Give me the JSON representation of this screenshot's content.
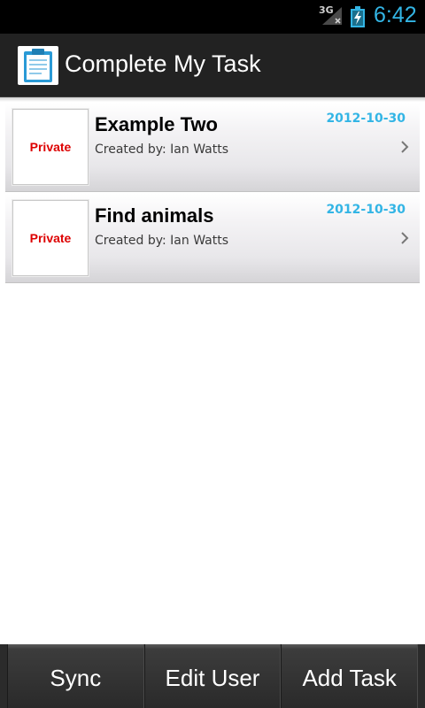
{
  "status_bar": {
    "network": "3G",
    "time": "6:42",
    "signal_icon": "signal-no-bars-icon",
    "battery_icon": "battery-charging-icon",
    "accent_color": "#33b5e5"
  },
  "action_bar": {
    "title": "Complete My Task",
    "icon": "clipboard-icon"
  },
  "tasks": [
    {
      "privacy": "Private",
      "title": "Example Two",
      "creator": "Created by: Ian Watts",
      "date": "2012-10-30"
    },
    {
      "privacy": "Private",
      "title": "Find animals",
      "creator": "Created by: Ian Watts",
      "date": "2012-10-30"
    }
  ],
  "bottom_bar": {
    "sync_label": "Sync",
    "edit_user_label": "Edit User",
    "add_task_label": "Add Task"
  },
  "colors": {
    "privacy_text": "#dd0000",
    "date_text": "#33b5e5",
    "action_bar_bg": "#222222"
  }
}
